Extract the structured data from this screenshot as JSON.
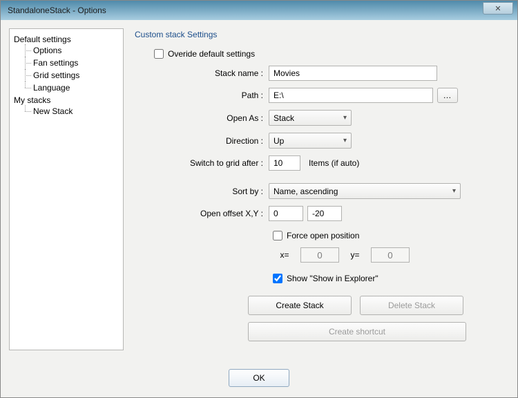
{
  "window": {
    "title": "StandaloneStack - Options",
    "close_glyph": "✕"
  },
  "tree": {
    "root1": "Default settings",
    "root1_children": [
      "Options",
      "Fan settings",
      "Grid settings",
      "Language"
    ],
    "root2": "My stacks",
    "root2_children": [
      "New Stack"
    ]
  },
  "form": {
    "group_title": "Custom stack Settings",
    "override_label": "Overide default  settings",
    "override_checked": false,
    "stack_name_label": "Stack name :",
    "stack_name_value": "Movies",
    "path_label": "Path :",
    "path_value": "E:\\",
    "browse_label": "…",
    "open_as_label": "Open As :",
    "open_as_value": "Stack",
    "direction_label": "Direction :",
    "direction_value": "Up",
    "switch_label": "Switch to grid after :",
    "switch_value": "10",
    "switch_suffix": "Items (if auto)",
    "sort_label": "Sort by :",
    "sort_value": "Name, ascending",
    "offset_label": "Open offset X,Y :",
    "offset_x": "0",
    "offset_y": "-20",
    "force_open_label": "Force open position",
    "force_open_checked": false,
    "coord_x_label": "x=",
    "coord_x_value": "0",
    "coord_y_label": "y=",
    "coord_y_value": "0",
    "show_explorer_label": "Show \"Show in Explorer\"",
    "show_explorer_checked": true,
    "create_stack_label": "Create Stack",
    "delete_stack_label": "Delete Stack",
    "create_shortcut_label": "Create shortcut",
    "ok_label": "OK"
  }
}
